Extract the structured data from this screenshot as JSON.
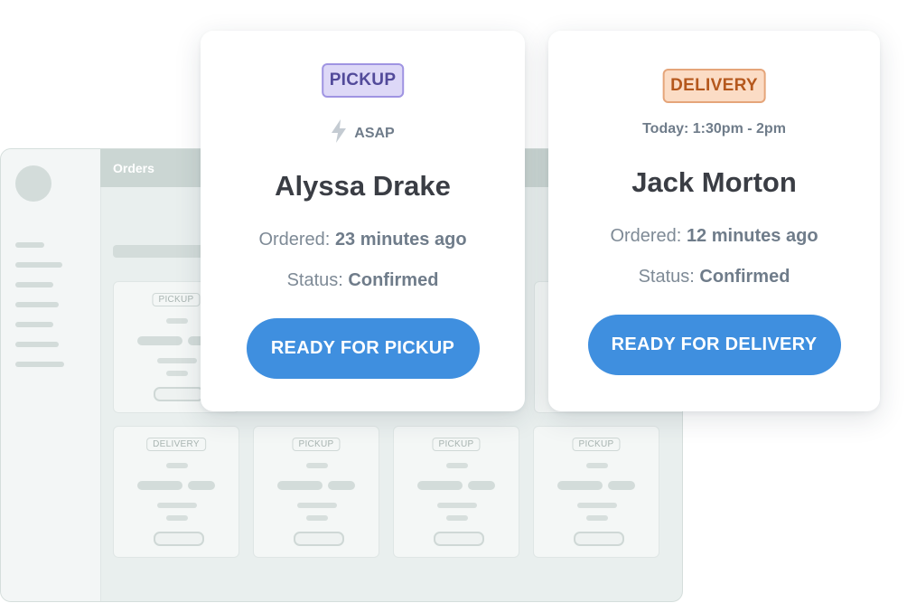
{
  "dashboard": {
    "header_title": "Orders",
    "cards": [
      {
        "badge": "PICKUP"
      },
      {
        "badge": "DELIVERY"
      },
      {
        "badge": "PICKUP"
      },
      {
        "badge": "PICKUP"
      },
      {
        "badge": "PICKUP"
      }
    ]
  },
  "orders": [
    {
      "type_badge": "PICKUP",
      "timing": "ASAP",
      "timing_icon": "lightning-bolt-icon",
      "customer_name": "Alyssa Drake",
      "ordered_label": "Ordered:",
      "ordered_value": "23 minutes ago",
      "status_label": "Status:",
      "status_value": "Confirmed",
      "action_label": "READY FOR PICKUP"
    },
    {
      "type_badge": "DELIVERY",
      "timing": "Today: 1:30pm - 2pm",
      "customer_name": "Jack Morton",
      "ordered_label": "Ordered:",
      "ordered_value": "12 minutes ago",
      "status_label": "Status:",
      "status_value": "Confirmed",
      "action_label": "READY FOR DELIVERY"
    }
  ],
  "colors": {
    "accent_blue": "#3f8fdf",
    "pickup_badge_bg": "#ddd8f7",
    "pickup_badge_text": "#524a9a",
    "delivery_badge_bg": "#fbdcc5",
    "delivery_badge_text": "#b5581d"
  }
}
